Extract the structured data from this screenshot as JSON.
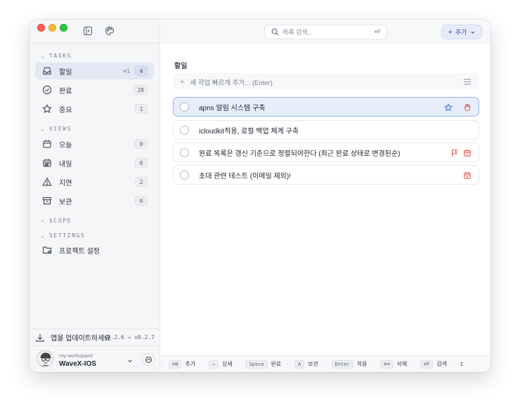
{
  "sidebar": {
    "sections": {
      "tasks": "TASKS",
      "views": "VIEWS",
      "scope": "SCOPE",
      "settings": "SETTINGS"
    },
    "items": [
      {
        "label": "할일",
        "shortcut": "⌘1",
        "count": "4",
        "icon": "inbox-icon"
      },
      {
        "label": "완료",
        "count": "28",
        "icon": "check-circle-icon"
      },
      {
        "label": "중요",
        "count": "1",
        "icon": "star-icon"
      },
      {
        "label": "오늘",
        "count": "0",
        "icon": "calendar-icon"
      },
      {
        "label": "내일",
        "count": "0",
        "icon": "calendar-grid-icon"
      },
      {
        "label": "지연",
        "count": "2",
        "icon": "warning-icon"
      },
      {
        "label": "보관",
        "count": "0",
        "icon": "archive-icon"
      }
    ],
    "project_settings": "프로젝트 설정",
    "update": {
      "label": "앱을 업데이트하세요",
      "version": "v0.2.6 → v0.2.7"
    },
    "workspace": {
      "small": "my-workspace",
      "name": "WaveX-IOS"
    }
  },
  "header": {
    "search_placeholder": "목록 검색...",
    "search_shortcut": "⌘F",
    "add_label": "추가"
  },
  "main": {
    "title": "할일",
    "quick_add_placeholder": "새 작업 빠르게 추가... (Enter)",
    "tasks": [
      {
        "title": "apns 알림 시스템 구축"
      },
      {
        "title": "icloudkit적용, 로컬 백업 체계 구축"
      },
      {
        "title": "완료 목록은 갱신 기준으로 정렬되야한다 (최근 완료 상태로 변경된순)"
      },
      {
        "title": "초대 관련 테스트 (이메일 제외)!"
      }
    ]
  },
  "footer": {
    "hints": [
      {
        "key": "⌘N",
        "label": "추가"
      },
      {
        "key": "→",
        "label": "상세"
      },
      {
        "key": "Space",
        "label": "완료"
      },
      {
        "key": "A",
        "label": "보관"
      },
      {
        "key": "Enter",
        "label": "적용"
      },
      {
        "key": "⌘⌫",
        "label": "삭제"
      },
      {
        "key": "⌘F",
        "label": "검색"
      },
      {
        "key": "I",
        "label": ""
      }
    ]
  },
  "colors": {
    "accent": "#2f4fa0",
    "selected_row": "#e7eefb",
    "star": "#4f79d6",
    "flag": "#e05252",
    "calendar_due": "#e05252"
  }
}
